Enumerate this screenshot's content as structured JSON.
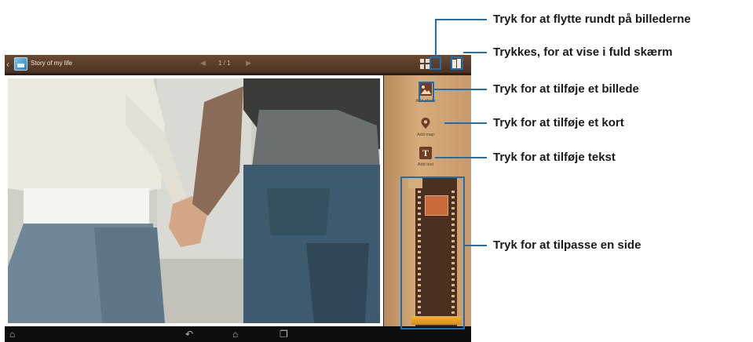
{
  "app": {
    "title": "Story of my life",
    "page_indicator": "1 / 1",
    "prev_glyph": "◀",
    "next_glyph": "▶",
    "back_glyph": "‹"
  },
  "tools": {
    "add_photo": {
      "label": "Add photo",
      "icon": "image-icon"
    },
    "add_map": {
      "label": "Add map",
      "icon": "map-pin-icon"
    },
    "add_text": {
      "label": "Add text",
      "icon": "text-icon",
      "glyph": "T"
    }
  },
  "navbar": {
    "home_left": "⌂",
    "back": "↶",
    "home": "⌂",
    "recent": "❐"
  },
  "annotations": [
    "Tryk for at flytte rundt på billederne",
    "Trykkes, for at vise i fuld skærm",
    "Tryk for at tilføje et billede",
    "Tryk for at tilføje et kort",
    "Tryk for at tilføje tekst",
    "Tryk for at tilpasse en side"
  ],
  "colors": {
    "callout": "#1d6fb3",
    "topbar": "#5a3d29",
    "panel": "#c9996a"
  }
}
